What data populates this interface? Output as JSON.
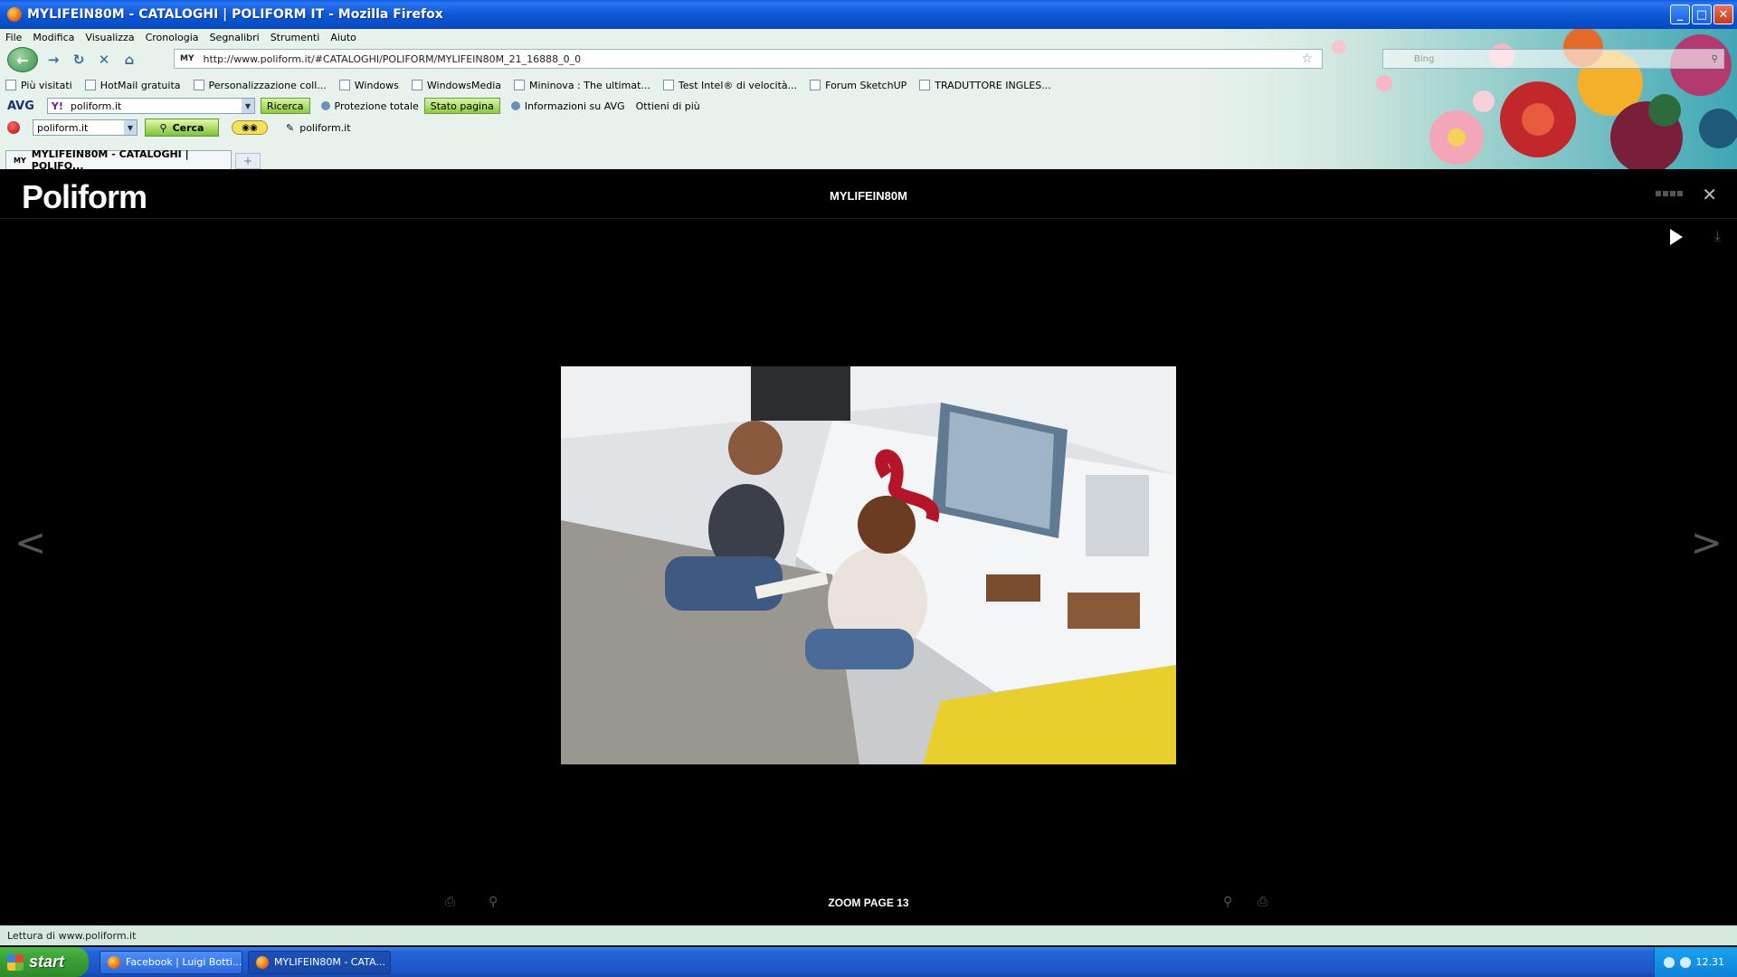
{
  "window": {
    "title": "MYLIFEIN80M - CATALOGHI | POLIFORM IT - Mozilla Firefox",
    "controls": {
      "minimize": "_",
      "maximize": "□",
      "close": "✕"
    }
  },
  "menu": [
    "File",
    "Modifica",
    "Visualizza",
    "Cronologia",
    "Segnalibri",
    "Strumenti",
    "Aiuto"
  ],
  "nav": {
    "url": "http://www.poliform.it/#CATALOGHI/POLIFORM/MYLIFEIN80M_21_16888_0_0",
    "url_favicon": "MY",
    "search_placeholder": "Bing"
  },
  "bookmarks": [
    "Più visitati",
    "HotMail gratuita",
    "Personalizzazione coll...",
    "Windows",
    "WindowsMedia",
    "Mininova : The ultimat...",
    "Test Intel® di velocità...",
    "Forum SketchUP",
    "TRADUTTORE INGLES..."
  ],
  "avg_toolbar": {
    "logo": "AVG",
    "search_value": "poliform.it",
    "ricerca_label": "Ricerca",
    "protezione_label": "Protezione totale",
    "stato_label": "Stato pagina",
    "info_label": "Informazioni su AVG",
    "ottieni_label": "Ottieni di più"
  },
  "yahoo_toolbar": {
    "search_value": "poliform.it",
    "cerca_label": "Cerca",
    "site_label": "poliform.it"
  },
  "tab": {
    "label": "MYLIFEIN80M - CATALOGHI | POLIFO...",
    "favicon": "MY",
    "newtab": "+"
  },
  "page": {
    "brand": "Poliform",
    "catalog_title": "MYLIFEIN80M",
    "prev_arrow": "<",
    "next_arrow": ">",
    "zoom_label": "ZOOM PAGE 13",
    "close_glyph": "✕"
  },
  "status": {
    "text": "Lettura di www.poliform.it"
  },
  "taskbar": {
    "start_label": "start",
    "tasks": [
      "Facebook | Luigi Botti...",
      "MYLIFEIN80M - CATA..."
    ],
    "clock": "12.31"
  },
  "colors": {
    "titlebar": "#0b56d6",
    "page_bg": "#000000",
    "taskbar": "#2466d6",
    "start_green": "#3aa135"
  }
}
